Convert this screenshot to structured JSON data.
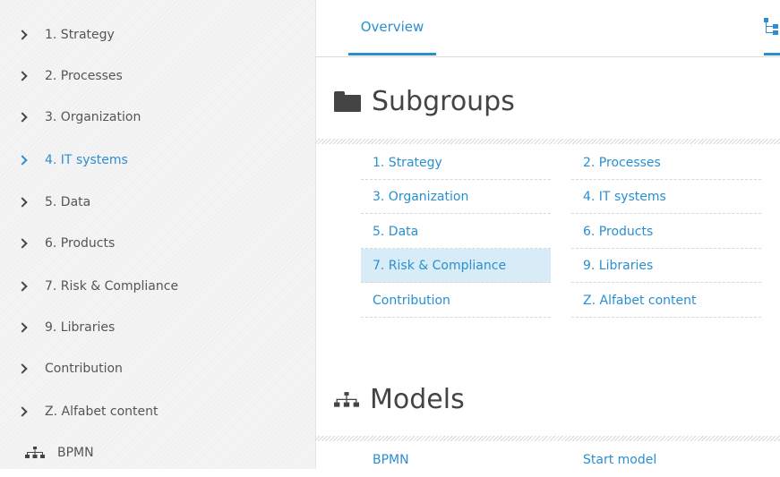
{
  "sidebar": {
    "items": [
      {
        "label": "1. Strategy"
      },
      {
        "label": "2. Processes"
      },
      {
        "label": "3. Organization"
      },
      {
        "label": "4. IT systems",
        "active": true
      },
      {
        "label": "5. Data"
      },
      {
        "label": "6. Products"
      },
      {
        "label": "7. Risk & Compliance"
      },
      {
        "label": "9. Libraries"
      },
      {
        "label": "Contribution"
      },
      {
        "label": "Z. Alfabet content"
      }
    ],
    "model_item": {
      "label": "BPMN",
      "icon": "hierarchy-icon"
    }
  },
  "tabs": {
    "overview_label": "Overview",
    "right_icon": "tree-structure-icon"
  },
  "subgroups": {
    "title": "Subgroups",
    "icon": "folder-icon",
    "items": [
      {
        "label": "1. Strategy"
      },
      {
        "label": "2. Processes"
      },
      {
        "label": "3. Organization"
      },
      {
        "label": "4. IT systems"
      },
      {
        "label": "5. Data"
      },
      {
        "label": "6. Products"
      },
      {
        "label": "7. Risk & Compliance",
        "highlighted": true
      },
      {
        "label": "9. Libraries"
      },
      {
        "label": "Contribution"
      },
      {
        "label": "Z. Alfabet content"
      }
    ]
  },
  "models": {
    "title": "Models",
    "icon": "hierarchy-icon",
    "items": [
      {
        "label": "BPMN"
      },
      {
        "label": "Start model"
      }
    ]
  },
  "colors": {
    "accent": "#2a8fd0",
    "highlight": "#d8ecf8",
    "sidebar_bg": "#f4f4f4",
    "text_dark": "#444444"
  }
}
